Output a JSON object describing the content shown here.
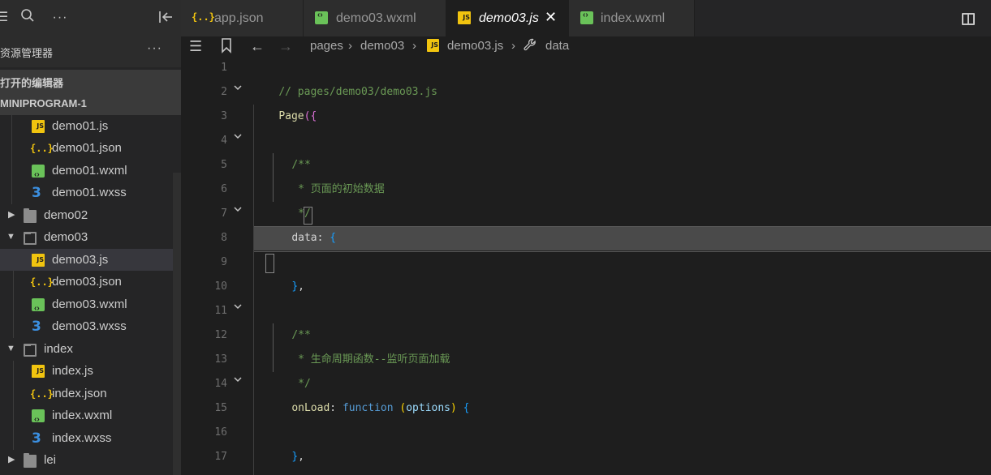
{
  "sidebar": {
    "top_icons": [
      "menu-icon",
      "search-icon",
      "more-icon",
      "collapse-panel-icon"
    ],
    "explorer_title": "资源管理器",
    "explorer_more": "···",
    "open_editors": "打开的编辑器",
    "project": "MINIPROGRAM-1",
    "tree": [
      {
        "label": "demo01.js",
        "type": "js"
      },
      {
        "label": "demo01.json",
        "type": "json"
      },
      {
        "label": "demo01.wxml",
        "type": "wxml"
      },
      {
        "label": "demo01.wxss",
        "type": "wxss"
      },
      {
        "label": "demo02",
        "type": "folder",
        "expanded": false
      },
      {
        "label": "demo03",
        "type": "folder",
        "expanded": true
      },
      {
        "label": "demo03.js",
        "type": "js",
        "selected": true
      },
      {
        "label": "demo03.json",
        "type": "json"
      },
      {
        "label": "demo03.wxml",
        "type": "wxml"
      },
      {
        "label": "demo03.wxss",
        "type": "wxss"
      },
      {
        "label": "index",
        "type": "folder",
        "expanded": true
      },
      {
        "label": "index.js",
        "type": "js"
      },
      {
        "label": "index.json",
        "type": "json"
      },
      {
        "label": "index.wxml",
        "type": "wxml"
      },
      {
        "label": "index.wxss",
        "type": "wxss"
      },
      {
        "label": "lei",
        "type": "folder",
        "expanded": false
      }
    ]
  },
  "tabs": [
    {
      "label": "app.json",
      "type": "json",
      "active": false
    },
    {
      "label": "demo03.wxml",
      "type": "wxml",
      "active": false
    },
    {
      "label": "demo03.js",
      "type": "js",
      "active": true,
      "close": "✕"
    },
    {
      "label": "index.wxml",
      "type": "wxml",
      "active": false
    }
  ],
  "breadcrumb": {
    "items": [
      "pages",
      "demo03",
      "demo03.js",
      "data"
    ]
  },
  "editor": {
    "lines": [
      {
        "num": "1",
        "text": "// pages/demo03/demo03.js"
      },
      {
        "num": "2",
        "text": "Page({",
        "fold": true
      },
      {
        "num": "3",
        "text": ""
      },
      {
        "num": "4",
        "text": "/**",
        "fold": true
      },
      {
        "num": "5",
        "text": " * 页面的初始数据"
      },
      {
        "num": "6",
        "text": " */"
      },
      {
        "num": "7",
        "text": "data: {",
        "fold": true
      },
      {
        "num": "8",
        "text": ""
      },
      {
        "num": "9",
        "text": "},"
      },
      {
        "num": "10",
        "text": ""
      },
      {
        "num": "11",
        "text": "/**",
        "fold": true
      },
      {
        "num": "12",
        "text": " * 生命周期函数--监听页面加载"
      },
      {
        "num": "13",
        "text": " */"
      },
      {
        "num": "14",
        "text": "onLoad: function (options) {",
        "fold": true
      },
      {
        "num": "15",
        "text": ""
      },
      {
        "num": "16",
        "text": "},"
      },
      {
        "num": "17",
        "text": ""
      }
    ],
    "tokens": {
      "l1": "// pages/demo03/demo03.js",
      "l2a": "Page",
      "l2b": "(",
      "l2c": "{",
      "l4": "/**",
      "l5": " * 页面的初始数据",
      "l6": " */",
      "l7a": "data",
      "l7b": ": ",
      "l7c": "{",
      "l9a": "}",
      "l9b": ",",
      "l11": "/**",
      "l12": " * 生命周期函数--监听页面加载",
      "l13": " */",
      "l14a": "onLoad",
      "l14b": ": ",
      "l14c": "function",
      "l14d": " (",
      "l14e": "options",
      "l14f": ") ",
      "l14g": "{",
      "l16a": "}",
      "l16b": ","
    }
  },
  "colors": {
    "background": "#1e1e1e",
    "sidebar": "#252526",
    "comment": "#6a9955",
    "function": "#dcdcaa",
    "keyword": "#569cd6",
    "property": "#9cdcfe",
    "js_icon": "#f1c40f",
    "wxml_icon": "#6ac259",
    "wxss_icon": "#3b8fe0"
  }
}
